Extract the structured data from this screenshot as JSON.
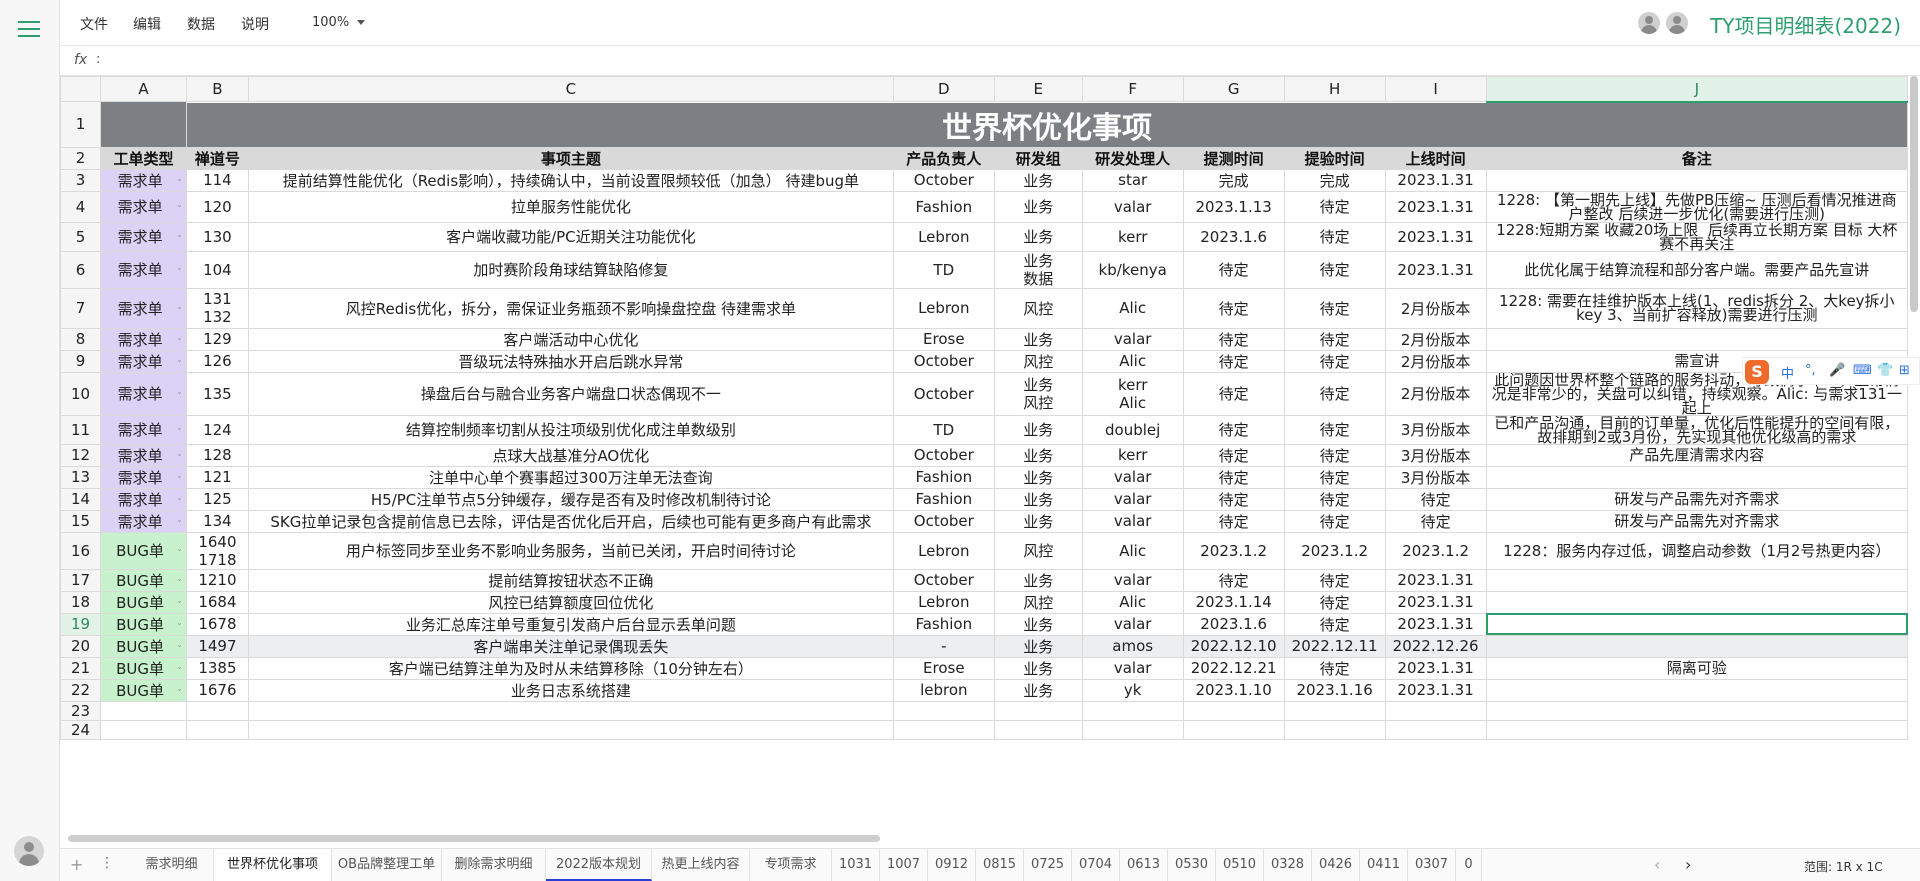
{
  "menu": {
    "file": "文件",
    "edit": "编辑",
    "data": "数据",
    "help": "说明",
    "zoom": "100%"
  },
  "doc_title": "TY项目明细表(2022)",
  "formula": {
    "fx": "fx",
    "colon": ":"
  },
  "columns": [
    "A",
    "B",
    "C",
    "D",
    "E",
    "F",
    "G",
    "H",
    "I",
    "J"
  ],
  "sheet_title": "世界杯优化事项",
  "headers": [
    "工单类型",
    "禅道号",
    "事项主题",
    "产品负责人",
    "研发组",
    "研发处理人",
    "提测时间",
    "提验时间",
    "上线时间",
    "备注"
  ],
  "rows": [
    {
      "type": "需求单",
      "id": "114",
      "subject": "提前结算性能优化（Redis影响），持续确认中，当前设置限频较低（加急） 待建bug单",
      "owner": "October",
      "group": "业务",
      "dev": "star",
      "test": "完成",
      "verify": "完成",
      "release": "2023.1.31",
      "note": ""
    },
    {
      "type": "需求单",
      "id": "120",
      "subject": "拉单服务性能优化",
      "owner": "Fashion",
      "group": "业务",
      "dev": "valar",
      "test": "2023.1.13",
      "verify": "待定",
      "release": "2023.1.31",
      "note": "1228: 【第一期先上线】先做PB压缩~ 压测后看情况推进商户整改 后续进一步优化(需要进行压测)"
    },
    {
      "type": "需求单",
      "id": "130",
      "subject": "客户端收藏功能/PC近期关注功能优化",
      "owner": "Lebron",
      "group": "业务",
      "dev": "kerr",
      "test": "2023.1.6",
      "verify": "待定",
      "release": "2023.1.31",
      "note": "1228:短期方案 收藏20场上限  后续再立长期方案 目标 大杯赛不再关注"
    },
    {
      "type": "需求单",
      "id": "104",
      "subject": "加时赛阶段角球结算缺陷修复",
      "owner": "TD",
      "group": "业务\n数据",
      "dev": "kb/kenya",
      "test": "待定",
      "verify": "待定",
      "release": "2023.1.31",
      "note": "此优化属于结算流程和部分客户端。需要产品先宣讲"
    },
    {
      "type": "需求单",
      "id": "131\n132",
      "subject": "风控Redis优化，拆分，需保证业务瓶颈不影响操盘控盘 待建需求单",
      "owner": "Lebron",
      "group": "风控",
      "dev": "Alic",
      "test": "待定",
      "verify": "待定",
      "release": "2月份版本",
      "note": "1228: 需要在挂维护版本上线(1、redis拆分 2、大key拆小key 3、当前扩容释放)需要进行压测"
    },
    {
      "type": "需求单",
      "id": "129",
      "subject": "客户端活动中心优化",
      "owner": "Erose",
      "group": "业务",
      "dev": "valar",
      "test": "待定",
      "verify": "待定",
      "release": "2月份版本",
      "note": ""
    },
    {
      "type": "需求单",
      "id": "126",
      "subject": "晋级玩法特殊抽水开启后跳水异常",
      "owner": "October",
      "group": "风控",
      "dev": "Alic",
      "test": "待定",
      "verify": "待定",
      "release": "2月份版本",
      "note": "需宣讲"
    },
    {
      "type": "需求单",
      "id": "135",
      "subject": "操盘后台与融合业务客户端盘口状态偶现不一",
      "owner": "October",
      "group": "业务\n风控",
      "dev": "kerr\nAlic",
      "test": "待定",
      "verify": "待定",
      "release": "2月份版本",
      "note": "此问题因世界杯整个链路的服务抖动，导致偶尔不一，正常情况是非常少的，关盘可以纠错，持续观察。Alic: 与需求131一起上"
    },
    {
      "type": "需求单",
      "id": "124",
      "subject": "结算控制频率切割从投注项级别优化成注单数级别",
      "owner": "TD",
      "group": "业务",
      "dev": "doublej",
      "test": "待定",
      "verify": "待定",
      "release": "3月份版本",
      "note": "已和产品沟通，目前的订单量，优化后性能提升的空间有限，\n故排期到2或3月份，先实现其他优化级高的需求"
    },
    {
      "type": "需求单",
      "id": "128",
      "subject": "点球大战基准分AO优化",
      "owner": "October",
      "group": "业务",
      "dev": "kerr",
      "test": "待定",
      "verify": "待定",
      "release": "3月份版本",
      "note": "产品先厘清需求内容"
    },
    {
      "type": "需求单",
      "id": "121",
      "subject": "注单中心单个赛事超过300万注单无法查询",
      "owner": "Fashion",
      "group": "业务",
      "dev": "valar",
      "test": "待定",
      "verify": "待定",
      "release": "3月份版本",
      "note": ""
    },
    {
      "type": "需求单",
      "id": "125",
      "subject": "H5/PC注单节点5分钟缓存，缓存是否有及时修改机制待讨论",
      "owner": "Fashion",
      "group": "业务",
      "dev": "valar",
      "test": "待定",
      "verify": "待定",
      "release": "待定",
      "note": "研发与产品需先对齐需求"
    },
    {
      "type": "需求单",
      "id": "134",
      "subject": "SKG拉单记录包含提前信息已去除，评估是否优化后开启，后续也可能有更多商户有此需求",
      "owner": "October",
      "group": "业务",
      "dev": "valar",
      "test": "待定",
      "verify": "待定",
      "release": "待定",
      "note": "研发与产品需先对齐需求"
    },
    {
      "type": "BUG单",
      "id": "1640\n1718",
      "subject": "用户标签同步至业务不影响业务服务，当前已关闭，开启时间待讨论",
      "owner": "Lebron",
      "group": "风控",
      "dev": "Alic",
      "test": "2023.1.2",
      "verify": "2023.1.2",
      "release": "2023.1.2",
      "note": "1228：服务内存过低，调整启动参数（1月2号热更内容）"
    },
    {
      "type": "BUG单",
      "id": "1210",
      "subject": "提前结算按钮状态不正确",
      "owner": "October",
      "group": "业务",
      "dev": "valar",
      "test": "待定",
      "verify": "待定",
      "release": "2023.1.31",
      "note": ""
    },
    {
      "type": "BUG单",
      "id": "1684",
      "subject": "风控已结算额度回位优化",
      "owner": "Lebron",
      "group": "风控",
      "dev": "Alic",
      "test": "2023.1.14",
      "verify": "待定",
      "release": "2023.1.31",
      "note": ""
    },
    {
      "type": "BUG单",
      "id": "1678",
      "subject": "业务汇总库注单号重复引发商户后台显示丢单问题",
      "owner": "Fashion",
      "group": "业务",
      "dev": "valar",
      "test": "2023.1.6",
      "verify": "待定",
      "release": "2023.1.31",
      "note": ""
    },
    {
      "type": "BUG单",
      "id": "1497",
      "subject": "客户端串关注单记录偶现丢失",
      "owner": "-",
      "group": "业务",
      "dev": "amos",
      "test": "2022.12.10",
      "verify": "2022.12.11",
      "release": "2022.12.26",
      "note": ""
    },
    {
      "type": "BUG单",
      "id": "1385",
      "subject": "客户端已结算注单为及时从未结算移除（10分钟左右）",
      "owner": "Erose",
      "group": "业务",
      "dev": "valar",
      "test": "2022.12.21",
      "verify": "待定",
      "release": "2023.1.31",
      "note": "隔离可验"
    },
    {
      "type": "BUG单",
      "id": "1676",
      "subject": "业务日志系统搭建",
      "owner": "lebron",
      "group": "业务",
      "dev": "yk",
      "test": "2023.1.10",
      "verify": "2023.1.16",
      "release": "2023.1.31",
      "note": ""
    }
  ],
  "row_numbers": [
    "1",
    "2",
    "3",
    "4",
    "5",
    "6",
    "7",
    "8",
    "9",
    "10",
    "11",
    "12",
    "13",
    "14",
    "15",
    "16",
    "17",
    "18",
    "19",
    "20",
    "21",
    "22",
    "23",
    "24"
  ],
  "ime": {
    "logo": "S",
    "items": [
      "中",
      "°,",
      "🎤",
      "⌨",
      "👕",
      "⊞"
    ]
  },
  "tabs": [
    "需求明细",
    "世界杯优化事项",
    "OB品牌整理工单",
    "删除需求明细",
    "2022版本规划",
    "热更上线内容",
    "专项需求",
    "1031",
    "1007",
    "0912",
    "0815",
    "0725",
    "0704",
    "0613",
    "0530",
    "0510",
    "0328",
    "0426",
    "0411",
    "0307",
    "0"
  ],
  "active_tab": "世界杯优化事项",
  "range_label": "范围: 1R x 1C",
  "colors": {
    "accent": "#2e9f6c",
    "title_bg": "#7c7f84",
    "header_bg": "#d9d9d9",
    "req_bg": "#dcd2f6",
    "bug_bg": "#c8f2cd"
  }
}
